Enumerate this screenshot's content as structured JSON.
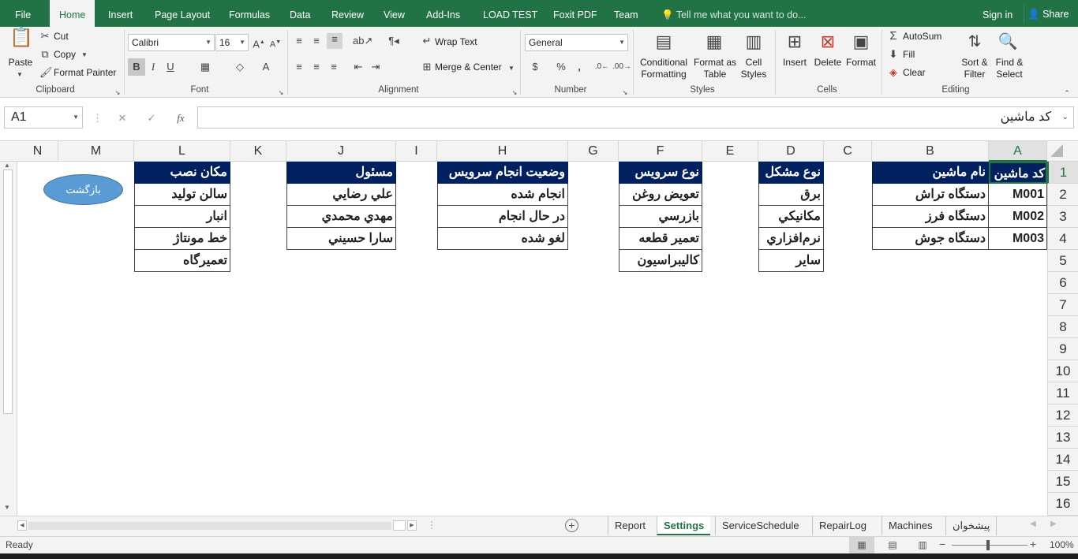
{
  "menu": {
    "file": "File",
    "tabs": [
      "Home",
      "Insert",
      "Page Layout",
      "Formulas",
      "Data",
      "Review",
      "View",
      "Add-Ins",
      "LOAD TEST",
      "Foxit PDF",
      "Team"
    ],
    "active_tab": "Home",
    "tell_me": "Tell me what you want to do...",
    "sign_in": "Sign in",
    "share": "Share"
  },
  "ribbon": {
    "clipboard": {
      "paste": "Paste",
      "cut": "Cut",
      "copy": "Copy",
      "format_painter": "Format Painter",
      "label": "Clipboard"
    },
    "font": {
      "name": "Calibri",
      "size": "16",
      "bold": "B",
      "italic": "I",
      "underline": "U",
      "label": "Font"
    },
    "alignment": {
      "wrap": "Wrap Text",
      "merge": "Merge & Center",
      "label": "Alignment"
    },
    "number": {
      "format": "General",
      "label": "Number"
    },
    "styles": {
      "conditional": "Conditional",
      "conditional2": "Formatting",
      "format_table": "Format as",
      "format_table2": "Table",
      "cell_styles": "Cell",
      "cell_styles2": "Styles",
      "label": "Styles"
    },
    "cells": {
      "insert": "Insert",
      "delete": "Delete",
      "format": "Format",
      "label": "Cells"
    },
    "editing": {
      "autosum": "AutoSum",
      "fill": "Fill",
      "clear": "Clear",
      "sort": "Sort &",
      "sort2": "Filter",
      "find": "Find &",
      "find2": "Select",
      "label": "Editing"
    }
  },
  "formula_bar": {
    "name_box": "A1",
    "fx": "fx",
    "content": "کد ماشین"
  },
  "columns": [
    "N",
    "M",
    "L",
    "K",
    "J",
    "I",
    "H",
    "G",
    "F",
    "E",
    "D",
    "C",
    "B",
    "A"
  ],
  "rows": [
    "1",
    "2",
    "3",
    "4",
    "5",
    "6",
    "7",
    "8",
    "9",
    "10",
    "11",
    "12",
    "13",
    "14",
    "15",
    "16"
  ],
  "tables": {
    "machines": {
      "headers": [
        "کد ماشین",
        "نام ماشین"
      ],
      "rows": [
        [
          "M001",
          "دستگاه تراش"
        ],
        [
          "M002",
          "دستگاه فرز"
        ],
        [
          "M003",
          "دستگاه جوش"
        ]
      ]
    },
    "problem_type": {
      "header": "نوع مشکل",
      "items": [
        "برق",
        "مکانیکي",
        "نرم‌افزاري",
        "ساير"
      ]
    },
    "service_type": {
      "header": "نوع سرويس",
      "items": [
        "تعويض روغن",
        "بازرسي",
        "تعمير قطعه",
        "کاليبراسيون"
      ]
    },
    "service_status": {
      "header": "وضعيت انجام سرويس",
      "items": [
        "انجام شده",
        "در حال انجام",
        "لغو شده"
      ]
    },
    "responsible": {
      "header": "مسئول",
      "items": [
        "علي رضايي",
        "مهدي محمدي",
        "سارا حسيني"
      ]
    },
    "location": {
      "header": "مکان نصب",
      "items": [
        "سالن توليد",
        "انبار",
        "خط مونتاژ",
        "تعميرگاه"
      ]
    }
  },
  "shape_button": "بازگشت",
  "sheets": [
    "Report",
    "Settings",
    "ServiceSchedule",
    "RepairLog",
    "Machines",
    "پیشخوان"
  ],
  "active_sheet": "Settings",
  "status": {
    "ready": "Ready",
    "zoom": "100%"
  },
  "colors": {
    "accent": "#217346",
    "header_fill": "#002060",
    "button_fill": "#5b9bd5"
  }
}
